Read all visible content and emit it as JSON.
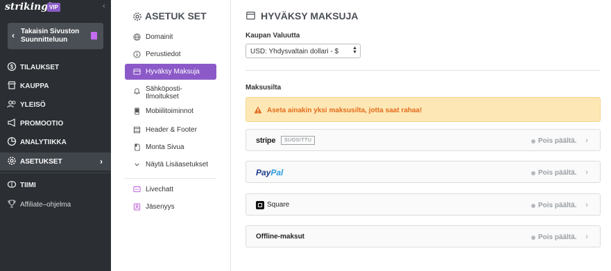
{
  "brand": {
    "name": "strikingly",
    "vip": "VIP"
  },
  "sidebar": {
    "back_label": "Takaisin Sivuston Suunnitteluun",
    "items": [
      {
        "label": "TILAUKSET",
        "icon": "dollar-icon"
      },
      {
        "label": "KAUPPA",
        "icon": "store-icon"
      },
      {
        "label": "YLEISÖ",
        "icon": "users-icon"
      },
      {
        "label": "PROMOOTIO",
        "icon": "megaphone-icon"
      },
      {
        "label": "ANALYTIIKKA",
        "icon": "pie-chart-icon"
      },
      {
        "label": "ASETUKSET",
        "icon": "gear-icon",
        "active": true
      },
      {
        "label": "TIIMI",
        "icon": "team-icon"
      },
      {
        "label": "Affiliate–ohjelma",
        "icon": "trophy-icon"
      }
    ]
  },
  "settings": {
    "title": "ASETUK SET",
    "items": [
      {
        "label": "Domainit",
        "icon": "globe-icon"
      },
      {
        "label": "Perustiedot",
        "icon": "info-icon"
      },
      {
        "label": "Hyväksy Maksuja",
        "icon": "card-icon",
        "active": true
      },
      {
        "label": "Sähköposti-Ilmoitukset",
        "icon": "bell-icon"
      },
      {
        "label": "Mobiilitoiminnot",
        "icon": "mobile-icon"
      },
      {
        "label": "Header & Footer",
        "icon": "layout-icon"
      },
      {
        "label": "Monta Sivua",
        "icon": "pages-icon"
      },
      {
        "label": "Näytä Lisäasetukset",
        "icon": "chevron-down-icon"
      },
      {
        "label": "Livechatt",
        "icon": "chat-icon"
      },
      {
        "label": "Jäsenyys",
        "icon": "member-icon"
      }
    ]
  },
  "main": {
    "title": "HYVÄKSY MAKSUJA",
    "currency_label": "Kaupan Valuutta",
    "currency_value": "USD: Yhdysvaltain dollari - $",
    "gateways_label": "Maksusilta",
    "alert": "Aseta ainakin yksi maksusilta, jotta saat rahaa!",
    "gateways": [
      {
        "name": "stripe",
        "badge": "SUOSITTU",
        "status": "Pois päältä."
      },
      {
        "name_a": "Pay",
        "name_b": "Pal",
        "status": "Pois päältä."
      },
      {
        "name": "Square",
        "status": "Pois päältä."
      },
      {
        "name": "Offline-maksut",
        "status": "Pois päältä."
      }
    ]
  },
  "colors": {
    "accent": "#8c5ac8",
    "sidebar": "#2b2f33",
    "alert_bg": "#fde8b5",
    "alert_text": "#e36b1c"
  }
}
